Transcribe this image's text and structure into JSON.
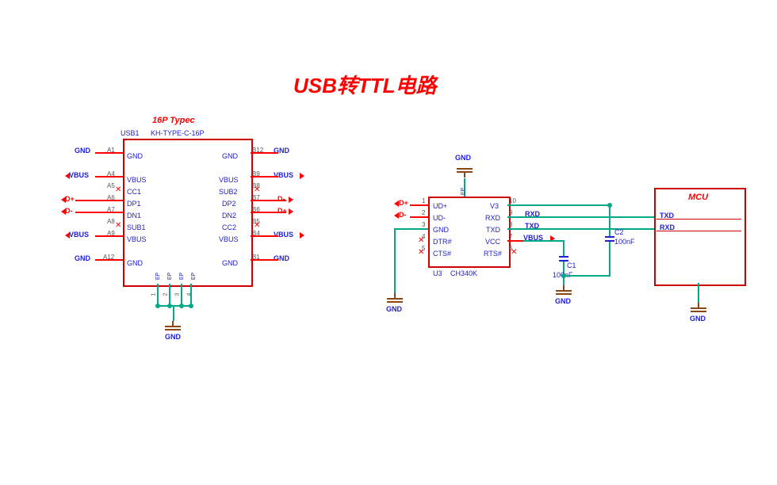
{
  "title": "USB转TTL电路",
  "usb": {
    "title": "16P Typec",
    "ref": "USB1",
    "part": "KH-TYPE-C-16P",
    "pins_left": [
      {
        "num": "A1",
        "name": "GND",
        "net": "GND"
      },
      {
        "num": "A4",
        "name": "VBUS",
        "net": "VBUS"
      },
      {
        "num": "A5",
        "name": "CC1",
        "net": ""
      },
      {
        "num": "A6",
        "name": "DP1",
        "net": "D+"
      },
      {
        "num": "A7",
        "name": "DN1",
        "net": "D-"
      },
      {
        "num": "A8",
        "name": "SUB1",
        "net": ""
      },
      {
        "num": "A9",
        "name": "VBUS",
        "net": "VBUS"
      },
      {
        "num": "A12",
        "name": "GND",
        "net": "GND"
      }
    ],
    "pins_right": [
      {
        "num": "B12",
        "name": "GND",
        "net": "GND"
      },
      {
        "num": "B9",
        "name": "VBUS",
        "net": "VBUS"
      },
      {
        "num": "B8",
        "name": "SUB2",
        "net": ""
      },
      {
        "num": "B7",
        "name": "DP2",
        "net": "D-"
      },
      {
        "num": "B6",
        "name": "DN2",
        "net": "D+"
      },
      {
        "num": "B5",
        "name": "CC2",
        "net": ""
      },
      {
        "num": "B4",
        "name": "VBUS",
        "net": "VBUS"
      },
      {
        "num": "B1",
        "name": "GND",
        "net": "GND"
      }
    ],
    "bottom_pins": [
      "EP",
      "EP",
      "EP",
      "EP"
    ],
    "gnd": "GND"
  },
  "ch340": {
    "ref": "U3",
    "part": "CH340K",
    "pins_left": [
      {
        "num": "1",
        "name": "UD+",
        "net": "D+"
      },
      {
        "num": "2",
        "name": "UD-",
        "net": "D-"
      },
      {
        "num": "3",
        "name": "GND",
        "net": ""
      },
      {
        "num": "4",
        "name": "DTR#",
        "net": ""
      },
      {
        "num": "5",
        "name": "CTS#",
        "net": ""
      }
    ],
    "pins_right": [
      {
        "num": "10",
        "name": "V3",
        "net": ""
      },
      {
        "num": "9",
        "name": "RXD",
        "net": "RXD"
      },
      {
        "num": "8",
        "name": "TXD",
        "net": "TXD"
      },
      {
        "num": "7",
        "name": "VCC",
        "net": "VBUS"
      },
      {
        "num": "6",
        "name": "RTS#",
        "net": ""
      }
    ],
    "top_gnd": "GND",
    "ep": "EP"
  },
  "mcu": {
    "title": "MCU",
    "txd": "TXD",
    "rxd": "RXD"
  },
  "caps": {
    "c1": {
      "ref": "C1",
      "val": "100nF"
    },
    "c2": {
      "ref": "C2",
      "val": "100nF"
    }
  },
  "gnd_label": "GND"
}
